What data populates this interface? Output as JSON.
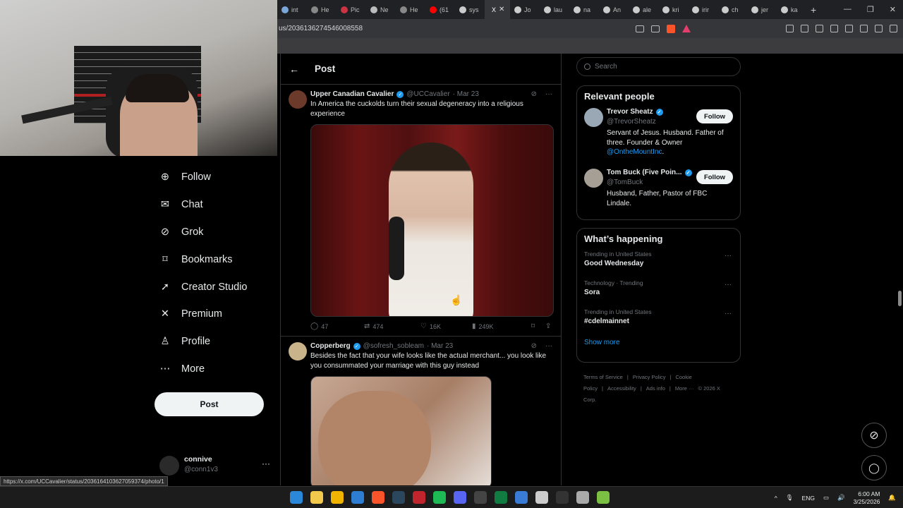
{
  "browser": {
    "tabs": [
      {
        "label": "int",
        "color": "#7aa7d8"
      },
      {
        "label": "He",
        "color": "#888888"
      },
      {
        "label": "Pic",
        "color": "#cc3344"
      },
      {
        "label": "Ne",
        "color": "#bbbbbb"
      },
      {
        "label": "He",
        "color": "#888888"
      },
      {
        "label": "(61",
        "color": "#ff0000"
      },
      {
        "label": "sys",
        "color": "#cccccc"
      },
      {
        "label": "X",
        "active": true
      },
      {
        "label": "Jo",
        "color": "#cccccc"
      },
      {
        "label": "lau",
        "color": "#cccccc"
      },
      {
        "label": "na",
        "color": "#cccccc"
      },
      {
        "label": "An",
        "color": "#cccccc"
      },
      {
        "label": "ale",
        "color": "#cccccc"
      },
      {
        "label": "kri",
        "color": "#cccccc"
      },
      {
        "label": "irir",
        "color": "#cccccc"
      },
      {
        "label": "ch",
        "color": "#cccccc"
      },
      {
        "label": "jer",
        "color": "#cccccc"
      },
      {
        "label": "ka",
        "color": "#cccccc"
      }
    ],
    "url": "us/2036136274546008558",
    "status_url": "https://x.com/UCCavalier/status/2036164103627059374/photo/1"
  },
  "nav": {
    "items": [
      {
        "label": "Follow",
        "icon": "person-add-icon",
        "glyph": "⊕"
      },
      {
        "label": "Chat",
        "icon": "mail-icon",
        "glyph": "✉"
      },
      {
        "label": "Grok",
        "icon": "grok-icon",
        "glyph": "⊘"
      },
      {
        "label": "Bookmarks",
        "icon": "bookmark-icon",
        "glyph": "⌑"
      },
      {
        "label": "Creator Studio",
        "icon": "rocket-icon",
        "glyph": "➚"
      },
      {
        "label": "Premium",
        "icon": "x-logo-icon",
        "glyph": "✕"
      },
      {
        "label": "Profile",
        "icon": "profile-icon",
        "glyph": "♙"
      },
      {
        "label": "More",
        "icon": "more-circle-icon",
        "glyph": "⋯"
      }
    ],
    "post_label": "Post",
    "account": {
      "name": "connive",
      "handle": "@conn1v3",
      "more": "···"
    }
  },
  "main": {
    "title": "Post",
    "back": "←",
    "tweets": [
      {
        "name": "Upper Canadian Cavalier",
        "handle": "@UCCavalier",
        "date": "· Mar 23",
        "text": "In America the cuckolds turn their sexual degeneracy into a religious experience",
        "avatar_color": "#6b3a2a",
        "replies": "47",
        "reposts": "474",
        "likes": "16K",
        "views": "249K"
      },
      {
        "name": "Copperberg",
        "handle": "@sofresh_sobleam",
        "date": "· Mar 23",
        "text": "Besides the fact that your wife looks like the actual merchant... you  look like you consummated your marriage with this guy instead",
        "avatar_color": "#c8b38a"
      }
    ]
  },
  "right": {
    "search_placeholder": "Search",
    "relevant_title": "Relevant people",
    "people": [
      {
        "name": "Trevor Sheatz",
        "handle": "@TrevorSheatz",
        "bio": "Servant of Jesus. Husband. Father of three. Founder & Owner ",
        "bio_link": "@OntheMountInc",
        "bio_end": ".",
        "follow": "Follow",
        "avatar_color": "#9aa7b5"
      },
      {
        "name": "Tom Buck (Five Poin...",
        "handle": "@TomBuck",
        "bio": "Husband, Father, Pastor of FBC Lindale.",
        "bio_link": "",
        "bio_end": "",
        "follow": "Follow",
        "avatar_color": "#a59f96"
      }
    ],
    "happening_title": "What’s happening",
    "trends": [
      {
        "context": "Trending in United States",
        "name": "Good Wednesday"
      },
      {
        "context": "Technology · Trending",
        "name": "Sora"
      },
      {
        "context": "Trending in United States",
        "name": "#cdelmainnet"
      }
    ],
    "show_more": "Show more",
    "footer": [
      "Terms of Service",
      "|",
      "Privacy Policy",
      "|",
      "Cookie Policy",
      "|",
      "Accessibility",
      "|",
      "Ads info",
      "|",
      "More ···",
      "© 2026 X Corp."
    ]
  },
  "taskbar": {
    "apps": [
      "#2b88d8",
      "#f2c94c",
      "#f0b400",
      "#2d7dd2",
      "#fb542b",
      "#2a475e",
      "#c0242c",
      "#1db954",
      "#5865f2",
      "#444444",
      "#107c41",
      "#3a7bd5",
      "#cccccc",
      "#333333",
      "#aaaaaa",
      "#7bc043"
    ],
    "lang": "ENG",
    "time": "6:00 AM",
    "date": "3/25/2026"
  }
}
